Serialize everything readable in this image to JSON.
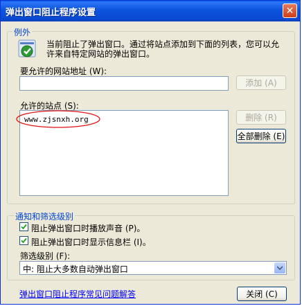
{
  "window": {
    "title": "弹出窗口阻止程序设置",
    "close_glyph": "✕"
  },
  "exceptions": {
    "legend": "例外",
    "info": "当前阻止了弹出窗口。通过将站点添加到下面的列表，您可以允许来自特定网站的弹出窗口。",
    "address_label": "要允许的网站地址 (W):",
    "address_value": "",
    "add_button": "添加 (A)",
    "allowed_label": "允许的站点 (S):",
    "allowed_sites": [
      "www.zjsnxh.org"
    ],
    "remove_button": "删除 (R)",
    "remove_all_button": "全部删除 (E)"
  },
  "notifications": {
    "legend": "通知和筛选级别",
    "play_sound": {
      "label": "阻止弹出窗口时播放声音 (P)。",
      "checked": true
    },
    "show_infobar": {
      "label": "阻止弹出窗口时显示信息栏 (I)。",
      "checked": true
    },
    "filter_label": "筛选级别 (F):",
    "filter_value": "中: 阻止大多数自动弹出窗口"
  },
  "footer": {
    "faq_link": "弹出窗口阻止程序常见问题解答",
    "close_button": "关闭 (C)"
  },
  "colors": {
    "title_bar": "#0a54e0",
    "legend_text": "#0046d5",
    "annotation": "#e01010"
  },
  "icons": [
    "shield-checkmark-icon",
    "close-icon",
    "checkbox-checked-icon",
    "dropdown-arrow-icon"
  ]
}
